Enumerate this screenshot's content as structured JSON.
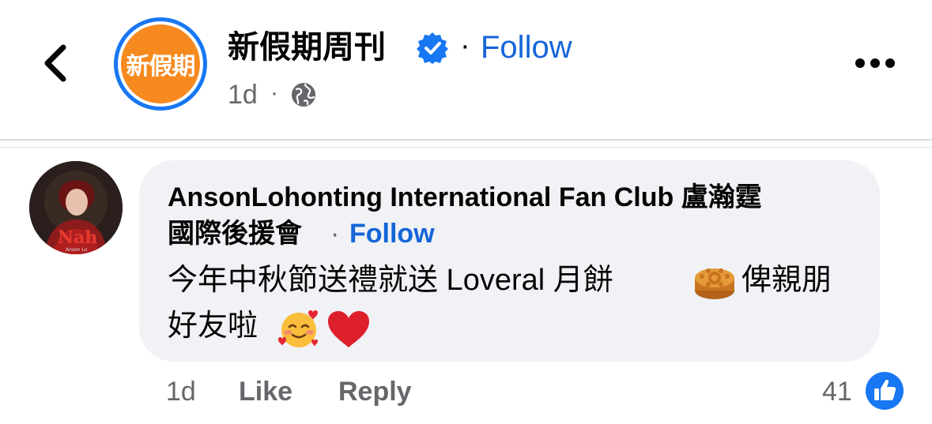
{
  "header": {
    "page_name": "新假期周刊",
    "logo_text": "新假期",
    "separator": "·",
    "follow_label": "Follow",
    "time": "1d",
    "time_separator": "·",
    "accent_color": "#1877f2"
  },
  "comment": {
    "avatar_text": "Nah",
    "avatar_subtext": "Anson Lo",
    "author_line1": "AnsonLohonting International Fan Club 盧瀚霆",
    "author_line2": "國際後援會",
    "separator": "·",
    "follow_label": "Follow",
    "text_line1": "今年中秋節送禮就送 Loveral 月餅",
    "text_line1_tail": "俾親朋",
    "text_line2": "好友啦",
    "emojis": [
      "mooncake-emoji",
      "smiling-face-with-hearts-emoji",
      "red-heart-emoji"
    ],
    "time": "1d",
    "like_label": "Like",
    "reply_label": "Reply",
    "reaction_count": "41",
    "reaction_type": "like"
  }
}
